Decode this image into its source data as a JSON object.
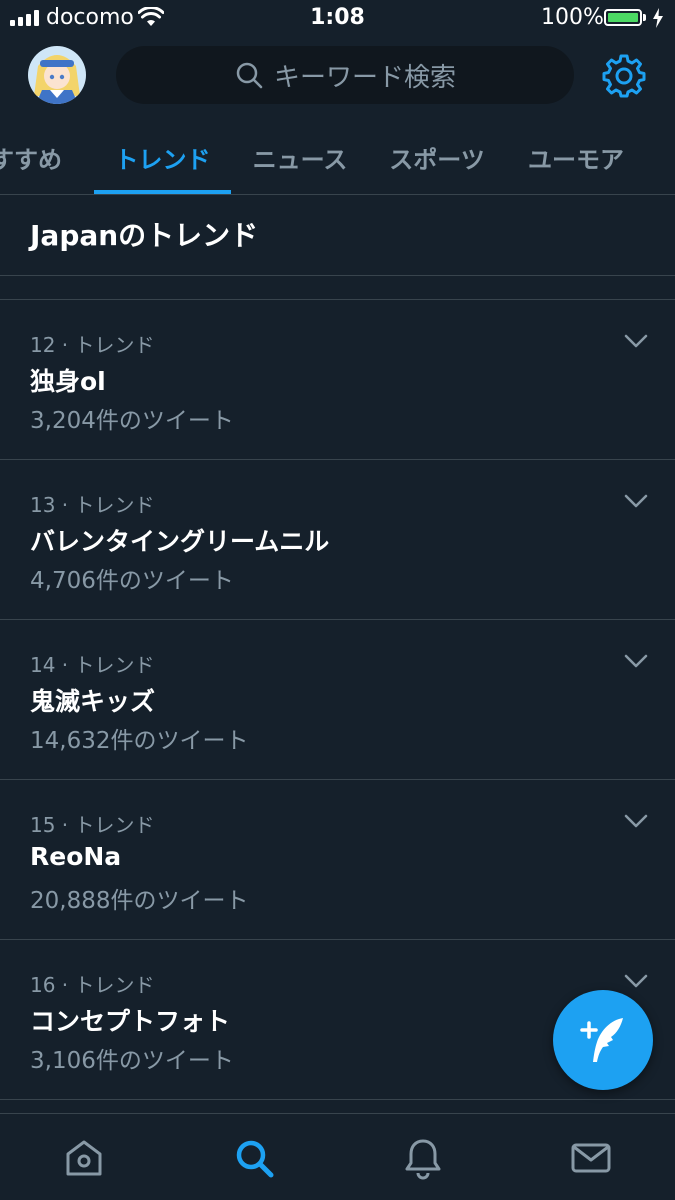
{
  "status_bar": {
    "carrier": "docomo",
    "time": "1:08",
    "battery": "100%"
  },
  "search": {
    "placeholder": "キーワード検索"
  },
  "tabs": [
    {
      "label": "すすめ",
      "active": false
    },
    {
      "label": "トレンド",
      "active": true
    },
    {
      "label": "ニュース",
      "active": false
    },
    {
      "label": "スポーツ",
      "active": false
    },
    {
      "label": "ユーモア",
      "active": false
    }
  ],
  "section_title": "Japanのトレンド",
  "trends": [
    {
      "meta": "12 · トレンド",
      "name": "独身ol",
      "count": "3,204件のツイート"
    },
    {
      "meta": "13 · トレンド",
      "name": "バレンタイングリームニル",
      "count": "4,706件のツイート"
    },
    {
      "meta": "14 · トレンド",
      "name": "鬼滅キッズ",
      "count": "14,632件のツイート"
    },
    {
      "meta": "15 · トレンド",
      "name": "ReoNa",
      "count": "20,888件のツイート"
    },
    {
      "meta": "16 · トレンド",
      "name": "コンセプトフォト",
      "count": "3,106件のツイート"
    }
  ],
  "bottom_nav": {
    "items": [
      "home-icon",
      "search-icon",
      "notifications-icon",
      "messages-icon"
    ],
    "active": "search-icon"
  },
  "colors": {
    "background": "#15202b",
    "accent": "#1da1f2",
    "secondary_text": "#8899a6",
    "divider": "#38444d",
    "battery": "#4cd964"
  }
}
